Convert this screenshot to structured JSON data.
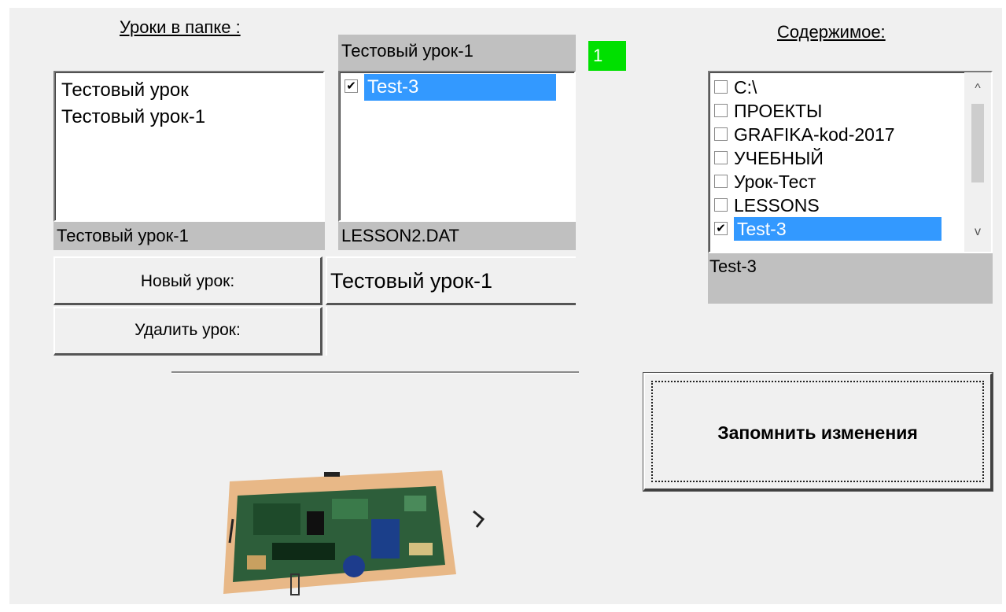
{
  "lessons": {
    "header": "Уроки в папке :",
    "items": [
      "Тестовый урок",
      "Тестовый урок-1"
    ],
    "selected_bar": "Тестовый урок-1"
  },
  "lesson_detail": {
    "header": "Тестовый урок-1",
    "badge": "1",
    "badge_color": "#00e000",
    "items": [
      {
        "label": "Test-3",
        "checked": true,
        "selected": true
      }
    ],
    "file_bar": "LESSON2.DAT"
  },
  "buttons": {
    "new_lesson": "Новый урок:",
    "delete_lesson": "Удалить урок:",
    "save_changes": "Запомнить изменения"
  },
  "lesson_name_input": {
    "value": "Тестовый урок-1"
  },
  "contents": {
    "header": "Содержимое:",
    "items": [
      {
        "label": "C:\\",
        "checked": false
      },
      {
        "label": "ПРОЕКТЫ",
        "checked": false
      },
      {
        "label": "GRAFIKA-kod-2017",
        "checked": false
      },
      {
        "label": "УЧЕБНЫЙ",
        "checked": false
      },
      {
        "label": "Урок-Тест",
        "checked": false
      },
      {
        "label": "LESSONS",
        "checked": false
      },
      {
        "label": "Test-3",
        "checked": true
      }
    ],
    "selected_bar": "Test-3"
  },
  "colors": {
    "selection": "#3399ff",
    "panel": "#f0f0f0",
    "bar": "#c0c0c0"
  }
}
